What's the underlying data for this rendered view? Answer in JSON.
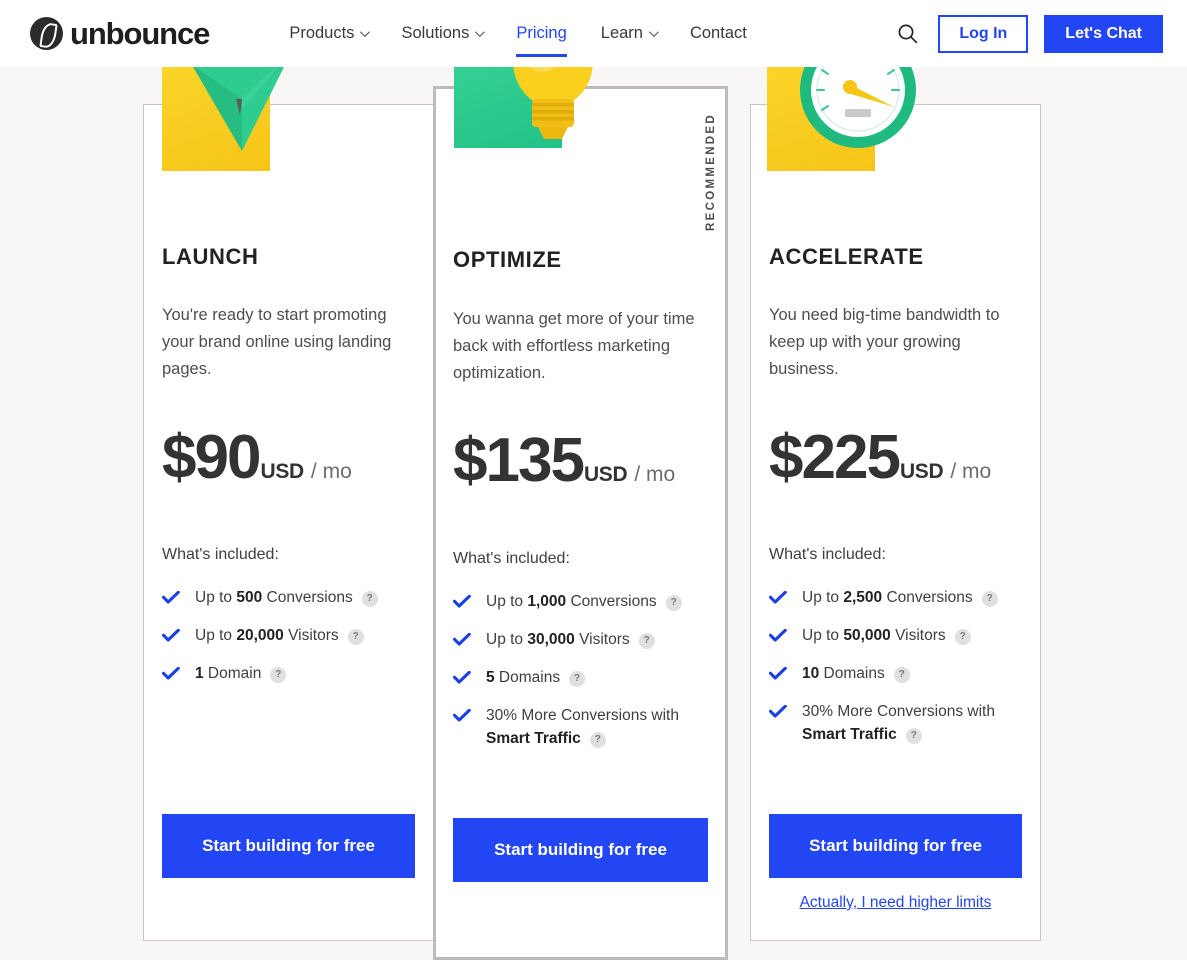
{
  "header": {
    "brand": "unbounce",
    "logo_icon": "unbounce-logo-icon",
    "nav": [
      {
        "label": "Products",
        "has_caret": true,
        "active": false
      },
      {
        "label": "Solutions",
        "has_caret": true,
        "active": false
      },
      {
        "label": "Pricing",
        "has_caret": false,
        "active": true
      },
      {
        "label": "Learn",
        "has_caret": true,
        "active": false
      },
      {
        "label": "Contact",
        "has_caret": false,
        "active": false
      }
    ],
    "search_icon": "search-icon",
    "login_label": "Log In",
    "chat_label": "Let's Chat",
    "accent_color": "#2346f5"
  },
  "pricing": {
    "included_label": "What's included:",
    "recommended_badge": "RECOMMENDED",
    "higher_limits_link": "Actually, I need higher limits",
    "plans": [
      {
        "name": "LAUNCH",
        "description": "You're ready to start promoting your brand online using landing pages.",
        "price_amount": "$90",
        "price_currency": "USD",
        "price_period": "/ mo",
        "cta_label": "Start building for free",
        "tile_color": "#f5c518",
        "art_icon": "paper-plane-icon",
        "features": [
          {
            "prefix": "Up to ",
            "value": "500",
            "suffix": " Conversions",
            "bold_all": false,
            "help": "?"
          },
          {
            "prefix": "Up to ",
            "value": "20,000",
            "suffix": " Visitors",
            "bold_all": false,
            "help": "?"
          },
          {
            "prefix": "",
            "value": "1",
            "suffix": " Domain",
            "bold_all": false,
            "help": "?"
          }
        ]
      },
      {
        "name": "OPTIMIZE",
        "description": "You wanna get more of your time back with effortless marketing optimization.",
        "price_amount": "$135",
        "price_currency": "USD",
        "price_period": "/ mo",
        "cta_label": "Start building for free",
        "tile_color": "#22c186",
        "art_icon": "lightbulb-icon",
        "features": [
          {
            "prefix": "Up to ",
            "value": "1,000",
            "suffix": " Conversions",
            "bold_all": false,
            "help": "?"
          },
          {
            "prefix": "Up to ",
            "value": "30,000",
            "suffix": " Visitors",
            "bold_all": false,
            "help": "?"
          },
          {
            "prefix": "",
            "value": "5",
            "suffix": " Domains",
            "bold_all": false,
            "help": "?"
          },
          {
            "prefix": "30% More Conversions with ",
            "value": "Smart Traffic",
            "suffix": "",
            "bold_all": false,
            "help": "?"
          }
        ]
      },
      {
        "name": "ACCELERATE",
        "description": "You need big-time bandwidth to keep up with your growing business.",
        "price_amount": "$225",
        "price_currency": "USD",
        "price_period": "/ mo",
        "cta_label": "Start building for free",
        "tile_color": "#f5c518",
        "art_icon": "speed-gauge-icon",
        "features": [
          {
            "prefix": "Up to ",
            "value": "2,500",
            "suffix": " Conversions",
            "bold_all": false,
            "help": "?"
          },
          {
            "prefix": "Up to ",
            "value": "50,000",
            "suffix": " Visitors",
            "bold_all": false,
            "help": "?"
          },
          {
            "prefix": "",
            "value": "10",
            "suffix": " Domains",
            "bold_all": false,
            "help": "?"
          },
          {
            "prefix": "30% More Conversions with ",
            "value": "Smart Traffic",
            "suffix": "",
            "bold_all": false,
            "help": "?"
          }
        ]
      }
    ]
  }
}
